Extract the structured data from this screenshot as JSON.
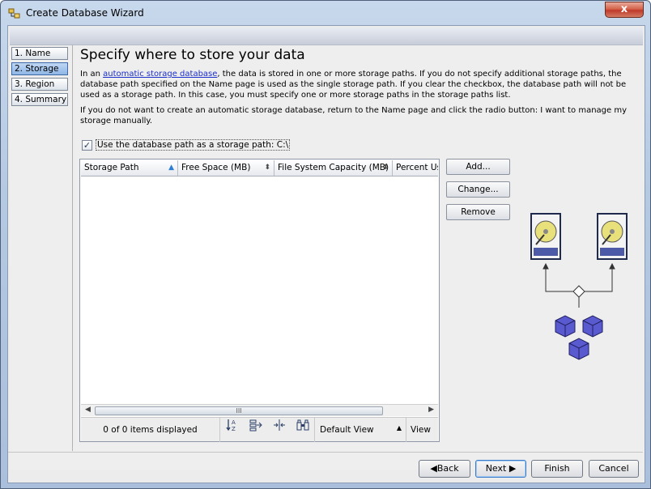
{
  "window": {
    "title": "Create Database Wizard",
    "close_label": "x"
  },
  "steps": [
    {
      "label": "1. Name",
      "active": false
    },
    {
      "label": "2. Storage",
      "active": true
    },
    {
      "label": "3. Region",
      "active": false
    },
    {
      "label": "4. Summary",
      "active": false
    }
  ],
  "page": {
    "heading": "Specify where to store your data",
    "para1_prefix": "In an ",
    "para1_link": "automatic storage database",
    "para1_suffix": ", the data is stored in one or more storage paths. If you do not specify additional storage paths, the database path specified on the Name page is used as the single storage path. If you clear the checkbox, the database path will not be used as a storage path. In this case, you must specify one or more storage paths in the storage paths list.",
    "para2": "If you do not want to create an automatic storage database, return to the Name page and click the radio button: I want to manage my storage manually.",
    "checkbox_label": "Use the database path as a storage path: C:\\",
    "checkbox_checked": true
  },
  "table": {
    "columns": [
      "Storage Path",
      "Free Space (MB)",
      "File System Capacity (MB)",
      "Percent Used"
    ],
    "rows": [],
    "scroll_thumb_mark": "III",
    "status": "0 of 0 items displayed",
    "view_select": "Default View",
    "view_button": "View"
  },
  "side_buttons": {
    "add": "Add...",
    "change": "Change...",
    "remove": "Remove"
  },
  "nav_buttons": {
    "back": "Back",
    "next": "Next",
    "finish": "Finish",
    "cancel": "Cancel"
  },
  "colors": {
    "link": "#1a2ec9",
    "cube": "#6a6ad6",
    "disk_frame": "#1f2a4f"
  }
}
